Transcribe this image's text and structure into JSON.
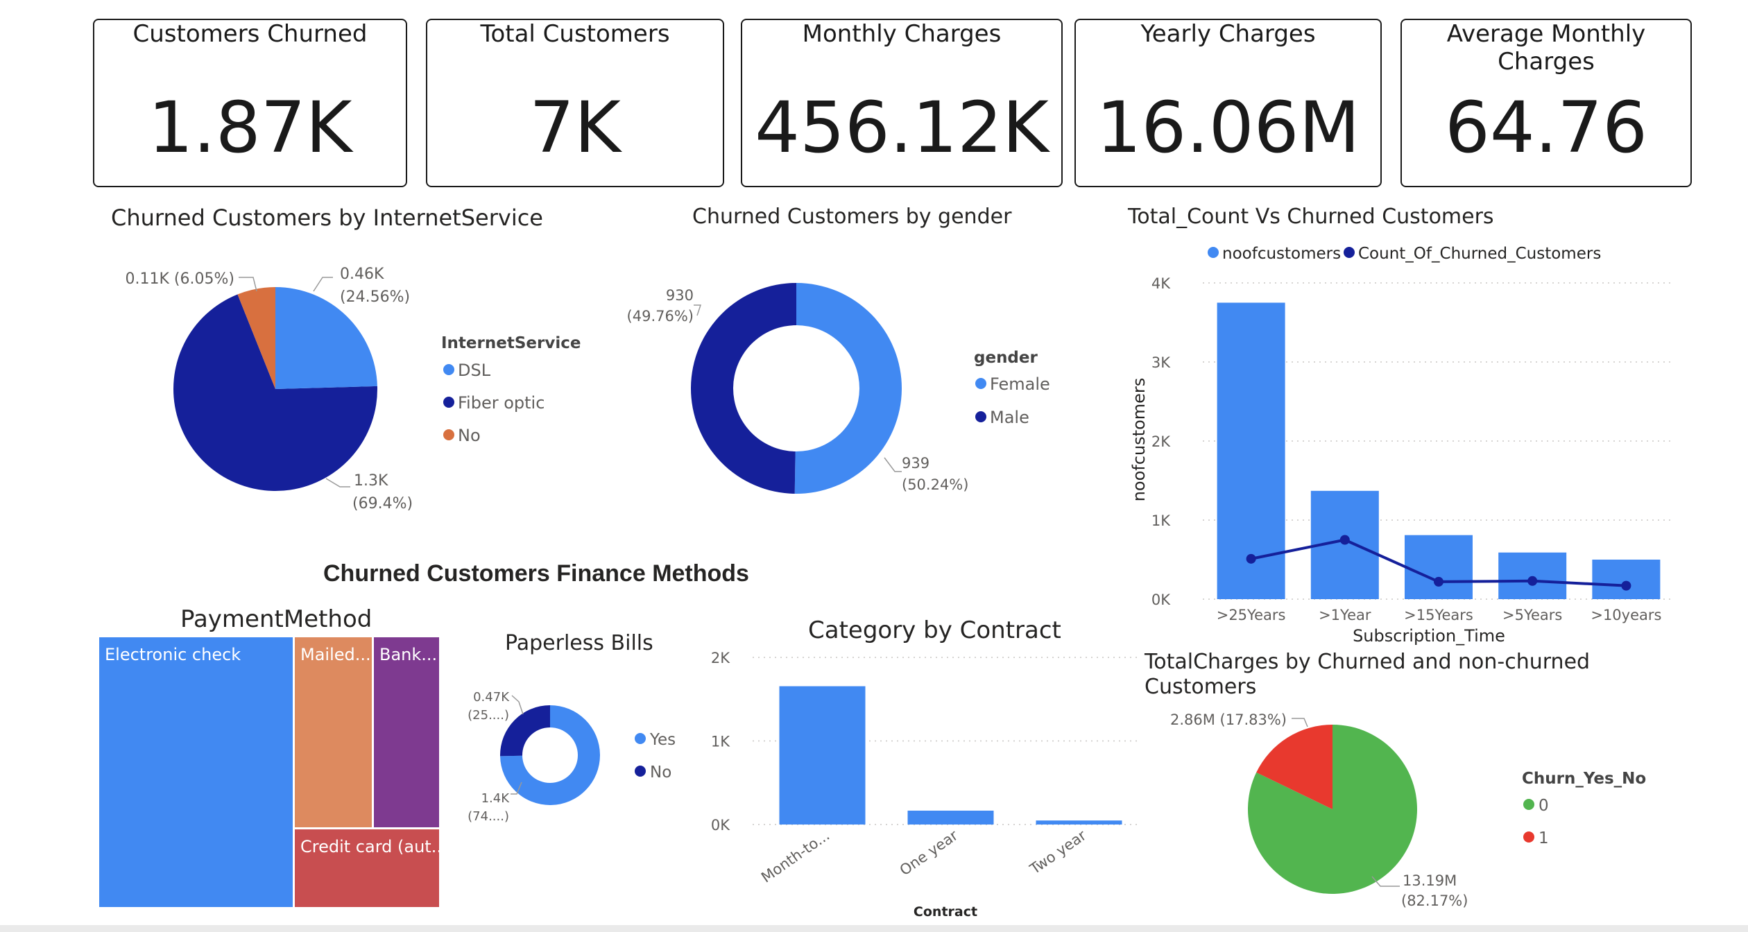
{
  "kpis": [
    {
      "title": "Customers Churned",
      "value": "1.87K"
    },
    {
      "title": "Total Customers",
      "value": "7K"
    },
    {
      "title": "Monthly Charges",
      "value": "456.12K"
    },
    {
      "title": "Yearly Charges",
      "value": "16.06M"
    },
    {
      "title": "Average Monthly Charges",
      "value": "64.76"
    }
  ],
  "section_title": "Churned Customers Finance Methods",
  "colors": {
    "light_blue": "#4189F2",
    "dark_blue": "#15209A",
    "orange": "#D8703F",
    "treemap_orange": "#DD8A5F",
    "purple": "#7E3A90",
    "red_card": "#C84E50",
    "green": "#52B54F",
    "red": "#E8392E"
  },
  "chart_data": [
    {
      "id": "internet_service",
      "type": "pie",
      "title": "Churned Customers by InternetService",
      "legend_title": "InternetService",
      "slices": [
        {
          "name": "DSL",
          "value": 0.46,
          "percent": 24.56,
          "label": "0.46K",
          "pct_label": "(24.56%)"
        },
        {
          "name": "Fiber optic",
          "value": 1.3,
          "percent": 69.4,
          "label": "1.3K",
          "pct_label": "(69.4%)"
        },
        {
          "name": "No",
          "value": 0.11,
          "percent": 6.05,
          "label": "0.11K (6.05%)",
          "pct_label": ""
        }
      ]
    },
    {
      "id": "gender",
      "type": "pie",
      "title": "Churned Customers by gender",
      "legend_title": "gender",
      "slices": [
        {
          "name": "Female",
          "value": 939,
          "percent": 50.24,
          "label": "939",
          "pct_label": "(50.24%)"
        },
        {
          "name": "Male",
          "value": 930,
          "percent": 49.76,
          "label": "930",
          "pct_label": "(49.76%)"
        }
      ]
    },
    {
      "id": "subscription",
      "type": "bar",
      "title": "Total_Count Vs Churned Customers",
      "legend": [
        "noofcustomers",
        "Count_Of_Churned_Customers"
      ],
      "xlabel": "Subscription_Time",
      "ylabel": "noofcustomers",
      "categories": [
        ">25Years",
        ">1Year",
        ">15Years",
        ">5Years",
        ">10years"
      ],
      "y_ticks": [
        "0K",
        "1K",
        "2K",
        "3K",
        "4K"
      ],
      "ylim": [
        0,
        4000
      ],
      "series": [
        {
          "name": "noofcustomers",
          "type": "bar",
          "values": [
            3750,
            1370,
            810,
            590,
            500
          ]
        },
        {
          "name": "Count_Of_Churned_Customers",
          "type": "line",
          "values": [
            510,
            750,
            220,
            230,
            170
          ]
        }
      ]
    },
    {
      "id": "payment_method",
      "type": "treemap",
      "title": "PaymentMethod",
      "cells": [
        {
          "name": "Electronic check",
          "label": "Electronic check"
        },
        {
          "name": "Mailed check",
          "label": "Mailed..."
        },
        {
          "name": "Bank transfer",
          "label": "Bank..."
        },
        {
          "name": "Credit card (automatic)",
          "label": "Credit card (aut..."
        }
      ]
    },
    {
      "id": "paperless",
      "type": "pie",
      "title": "Paperless Bills",
      "slices": [
        {
          "name": "Yes",
          "value": 1.4,
          "percent": 74.7,
          "label": "1.4K",
          "pct_label": "(74....)"
        },
        {
          "name": "No",
          "value": 0.47,
          "percent": 25.3,
          "label": "0.47K",
          "pct_label": "(25....)"
        }
      ]
    },
    {
      "id": "contract",
      "type": "bar",
      "title": "Category by Contract",
      "xlabel": "Contract",
      "categories": [
        "Month-to...",
        "One year",
        "Two year"
      ],
      "y_ticks": [
        "0K",
        "1K",
        "2K"
      ],
      "ylim": [
        0,
        2000
      ],
      "values": [
        1655,
        166,
        48
      ]
    },
    {
      "id": "total_charges",
      "type": "pie",
      "title_line1": "TotalCharges by Churned and non-churned",
      "title_line2": "Customers",
      "legend_title": "Churn_Yes_No",
      "slices": [
        {
          "name": "0",
          "value": 13.19,
          "percent": 82.17,
          "label": "13.19M",
          "pct_label": "(82.17%)"
        },
        {
          "name": "1",
          "value": 2.86,
          "percent": 17.83,
          "label": "2.86M (17.83%)",
          "pct_label": ""
        }
      ]
    }
  ]
}
